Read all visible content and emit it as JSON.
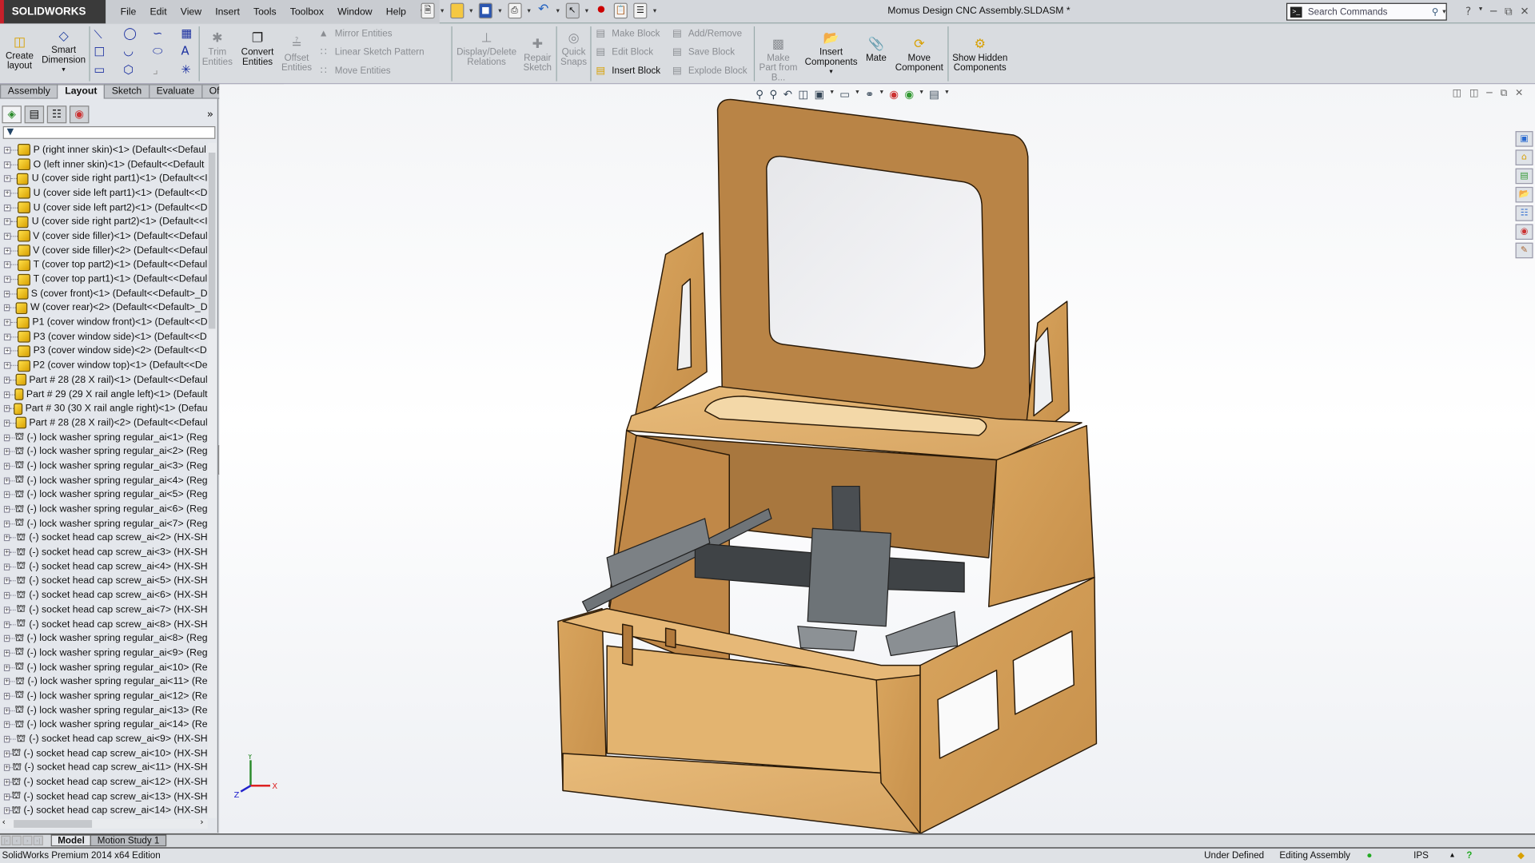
{
  "app": {
    "brand": "SOLIDWORKS",
    "document_title": "Momus Design CNC Assembly.SLDASM *"
  },
  "menu": [
    "File",
    "Edit",
    "View",
    "Insert",
    "Tools",
    "Toolbox",
    "Window",
    "Help"
  ],
  "search": {
    "placeholder": "Search Commands"
  },
  "command_manager": {
    "create_layout": "Create layout",
    "smart_dimension": "Smart Dimension",
    "trim_entities": "Trim Entities",
    "convert_entities": "Convert Entities",
    "offset_entities": "Offset Entities",
    "mirror_entities": "Mirror Entities",
    "linear_sketch_pattern": "Linear Sketch Pattern",
    "move_entities": "Move Entities",
    "display_delete_relations": "Display/Delete Relations",
    "repair_sketch": "Repair Sketch",
    "quick_snaps": "Quick Snaps",
    "make_block": "Make Block",
    "edit_block": "Edit Block",
    "insert_block": "Insert Block",
    "add_remove": "Add/Remove",
    "save_block": "Save Block",
    "explode_block": "Explode Block",
    "make_part_from_block": "Make Part from B...",
    "insert_components": "Insert Components",
    "mate": "Mate",
    "move_component": "Move Component",
    "show_hidden_components": "Show Hidden Components"
  },
  "tabs": [
    {
      "label": "Assembly",
      "active": false
    },
    {
      "label": "Layout",
      "active": true
    },
    {
      "label": "Sketch",
      "active": false
    },
    {
      "label": "Evaluate",
      "active": false
    },
    {
      "label": "Office Products",
      "active": false
    }
  ],
  "feature_tree": [
    {
      "label": "P (right inner skin)<1> (Default<<Defaul",
      "icon": "part"
    },
    {
      "label": "O (left inner skin)<1> (Default<<Default",
      "icon": "part"
    },
    {
      "label": "U (cover side right part1)<1> (Default<<I",
      "icon": "part"
    },
    {
      "label": "U (cover side left part1)<1> (Default<<D",
      "icon": "part"
    },
    {
      "label": "U (cover side left part2)<1> (Default<<D",
      "icon": "part"
    },
    {
      "label": "U (cover side right part2)<1> (Default<<I",
      "icon": "part"
    },
    {
      "label": "V (cover side filler)<1> (Default<<Defaul",
      "icon": "part"
    },
    {
      "label": "V (cover side filler)<2> (Default<<Defaul",
      "icon": "part"
    },
    {
      "label": "T (cover top part2)<1> (Default<<Defaul",
      "icon": "part"
    },
    {
      "label": "T (cover top part1)<1> (Default<<Defaul",
      "icon": "part"
    },
    {
      "label": "S (cover front)<1> (Default<<Default>_D",
      "icon": "part"
    },
    {
      "label": "W (cover rear)<2> (Default<<Default>_D",
      "icon": "part"
    },
    {
      "label": "P1 (cover window front)<1> (Default<<D",
      "icon": "part"
    },
    {
      "label": "P3 (cover window side)<1> (Default<<D",
      "icon": "part"
    },
    {
      "label": "P3 (cover window side)<2> (Default<<D",
      "icon": "part"
    },
    {
      "label": "P2 (cover window top)<1> (Default<<De",
      "icon": "part"
    },
    {
      "label": "Part # 28 (28 X rail)<1> (Default<<Defaul",
      "icon": "part"
    },
    {
      "label": "Part # 29 (29 X rail angle left)<1> (Default",
      "icon": "part"
    },
    {
      "label": "Part # 30 (30 X rail angle right)<1> (Defau",
      "icon": "part"
    },
    {
      "label": "Part # 28 (28 X rail)<2> (Default<<Defaul",
      "icon": "part"
    },
    {
      "label": "(-) lock washer spring regular_ai<1> (Reg",
      "icon": "fastener"
    },
    {
      "label": "(-) lock washer spring regular_ai<2> (Reg",
      "icon": "fastener"
    },
    {
      "label": "(-) lock washer spring regular_ai<3> (Reg",
      "icon": "fastener"
    },
    {
      "label": "(-) lock washer spring regular_ai<4> (Reg",
      "icon": "fastener"
    },
    {
      "label": "(-) lock washer spring regular_ai<5> (Reg",
      "icon": "fastener"
    },
    {
      "label": "(-) lock washer spring regular_ai<6> (Reg",
      "icon": "fastener"
    },
    {
      "label": "(-) lock washer spring regular_ai<7> (Reg",
      "icon": "fastener"
    },
    {
      "label": "(-) socket head cap screw_ai<2> (HX-SH",
      "icon": "fastener"
    },
    {
      "label": "(-) socket head cap screw_ai<3> (HX-SH",
      "icon": "fastener"
    },
    {
      "label": "(-) socket head cap screw_ai<4> (HX-SH",
      "icon": "fastener"
    },
    {
      "label": "(-) socket head cap screw_ai<5> (HX-SH",
      "icon": "fastener"
    },
    {
      "label": "(-) socket head cap screw_ai<6> (HX-SH",
      "icon": "fastener"
    },
    {
      "label": "(-) socket head cap screw_ai<7> (HX-SH",
      "icon": "fastener"
    },
    {
      "label": "(-) socket head cap screw_ai<8> (HX-SH",
      "icon": "fastener"
    },
    {
      "label": "(-) lock washer spring regular_ai<8> (Reg",
      "icon": "fastener"
    },
    {
      "label": "(-) lock washer spring regular_ai<9> (Reg",
      "icon": "fastener"
    },
    {
      "label": "(-) lock washer spring regular_ai<10> (Re",
      "icon": "fastener"
    },
    {
      "label": "(-) lock washer spring regular_ai<11> (Re",
      "icon": "fastener"
    },
    {
      "label": "(-) lock washer spring regular_ai<12> (Re",
      "icon": "fastener"
    },
    {
      "label": "(-) lock washer spring regular_ai<13> (Re",
      "icon": "fastener"
    },
    {
      "label": "(-) lock washer spring regular_ai<14> (Re",
      "icon": "fastener"
    },
    {
      "label": "(-) socket head cap screw_ai<9> (HX-SH",
      "icon": "fastener"
    },
    {
      "label": "(-) socket head cap screw_ai<10> (HX-SH",
      "icon": "fastener"
    },
    {
      "label": "(-) socket head cap screw_ai<11> (HX-SH",
      "icon": "fastener"
    },
    {
      "label": "(-) socket head cap screw_ai<12> (HX-SH",
      "icon": "fastener"
    },
    {
      "label": "(-) socket head cap screw_ai<13> (HX-SH",
      "icon": "fastener"
    },
    {
      "label": "(-) socket head cap screw_ai<14> (HX-SH",
      "icon": "fastener"
    }
  ],
  "bottom_tabs": [
    {
      "label": "Model",
      "active": true
    },
    {
      "label": "Motion Study 1",
      "active": false
    }
  ],
  "status": {
    "edition": "SolidWorks Premium 2014 x64 Edition",
    "definition": "Under Defined",
    "mode": "Editing Assembly",
    "units": "IPS"
  },
  "triad": {
    "x": "X",
    "y": "Y",
    "z": "Z"
  },
  "colors": {
    "wood": "#d9a55e",
    "wood_dark": "#b27a3c",
    "metal": "#6f7478",
    "brand_red": "#c8202a"
  }
}
